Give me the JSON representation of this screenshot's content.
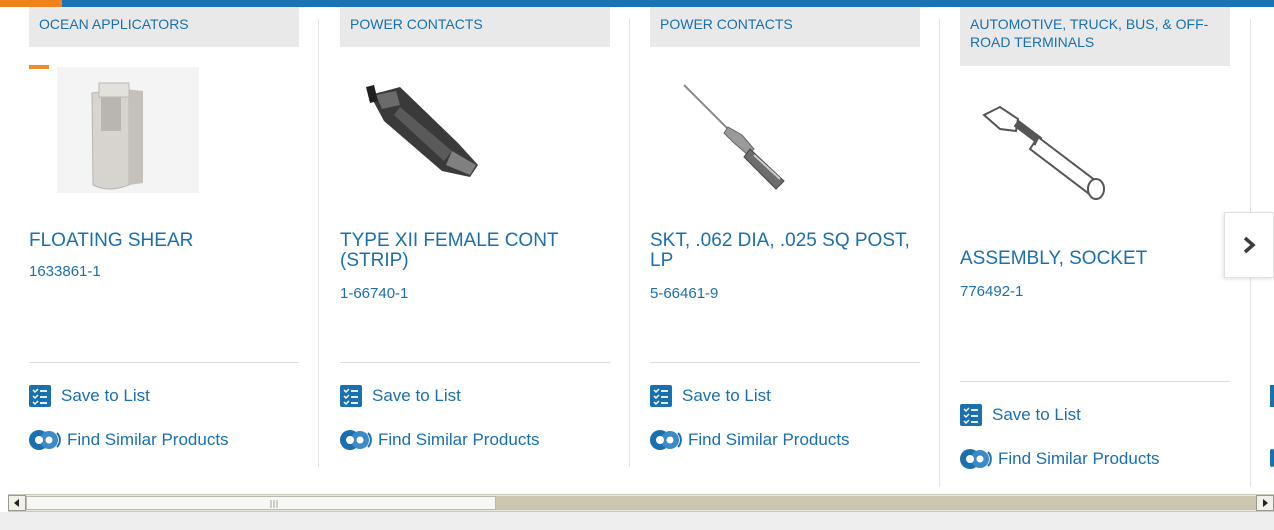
{
  "colors": {
    "link": "#1a6fae",
    "topbar": "#1a73b4",
    "accent": "#f0821e",
    "category_bg": "#e9e9e9"
  },
  "products": [
    {
      "category": "OCEAN APPLICATORS",
      "name": "FLOATING SHEAR",
      "part_number": "1633861-1",
      "save_label": "Save to List",
      "similar_label": "Find Similar Products"
    },
    {
      "category": "POWER CONTACTS",
      "name": "TYPE XII FEMALE CONT (STRIP)",
      "part_number": "1-66740-1",
      "save_label": "Save to List",
      "similar_label": "Find Similar Products"
    },
    {
      "category": "POWER CONTACTS",
      "name": "SKT, .062 DIA, .025 SQ POST, LP",
      "part_number": "5-66461-9",
      "save_label": "Save to List",
      "similar_label": "Find Similar Products"
    },
    {
      "category": "AUTOMOTIVE, TRUCK, BUS, & OFF-ROAD TERMINALS",
      "name": "ASSEMBLY, SOCKET",
      "part_number": "776492-1",
      "save_label": "Save to List",
      "similar_label": "Find Similar Products"
    }
  ],
  "carousel": {
    "next_icon": "chevron-right-icon"
  },
  "scrollbar": {
    "left_icon": "arrow-left-icon",
    "right_icon": "arrow-right-icon"
  }
}
